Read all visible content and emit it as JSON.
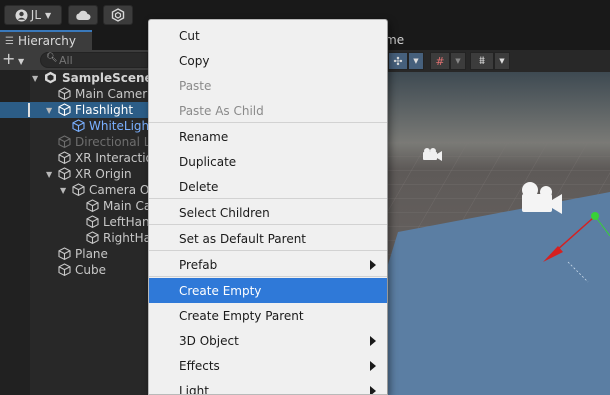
{
  "toolbar": {
    "account_label": "JL",
    "account_icon": "user-icon",
    "cloud_icon": "cloud-icon",
    "collab_icon": "collab-icon"
  },
  "hierarchy": {
    "tab_label": "Hierarchy",
    "search_placeholder": "All",
    "items": [
      {
        "label": "SampleScene*",
        "type": "scene"
      },
      {
        "label": "Main Camera",
        "type": "object"
      },
      {
        "label": "Flashlight",
        "type": "object",
        "selected": true
      },
      {
        "label": "WhiteLight",
        "type": "object",
        "style": "blue"
      },
      {
        "label": "Directional Li",
        "type": "object",
        "style": "dim"
      },
      {
        "label": "XR Interaction",
        "type": "object"
      },
      {
        "label": "XR Origin",
        "type": "object"
      },
      {
        "label": "Camera Of",
        "type": "object"
      },
      {
        "label": "Main Ca",
        "type": "object"
      },
      {
        "label": "LeftHan",
        "type": "object"
      },
      {
        "label": "RightHa",
        "type": "object"
      },
      {
        "label": "Plane",
        "type": "object"
      },
      {
        "label": "Cube",
        "type": "object"
      }
    ]
  },
  "scene": {
    "tab_label_fragment": "me",
    "colors": {
      "sky": "#4a4a4a",
      "ground": "#6f6a68",
      "plane": "#5a7ca0",
      "gizmo_x": "#d62020",
      "gizmo_y": "#38d038"
    }
  },
  "context_menu": {
    "items": [
      {
        "label": "Cut"
      },
      {
        "label": "Copy"
      },
      {
        "label": "Paste",
        "disabled": true
      },
      {
        "label": "Paste As Child",
        "disabled": true
      },
      {
        "label": "Rename"
      },
      {
        "label": "Duplicate"
      },
      {
        "label": "Delete"
      },
      {
        "label": "Select Children"
      },
      {
        "label": "Set as Default Parent"
      },
      {
        "label": "Prefab",
        "submenu": true
      },
      {
        "label": "Create Empty",
        "highlighted": true
      },
      {
        "label": "Create Empty Parent"
      },
      {
        "label": "3D Object",
        "submenu": true
      },
      {
        "label": "Effects",
        "submenu": true
      },
      {
        "label": "Light",
        "submenu": true
      }
    ],
    "highlight_color": "#2f79d8"
  }
}
